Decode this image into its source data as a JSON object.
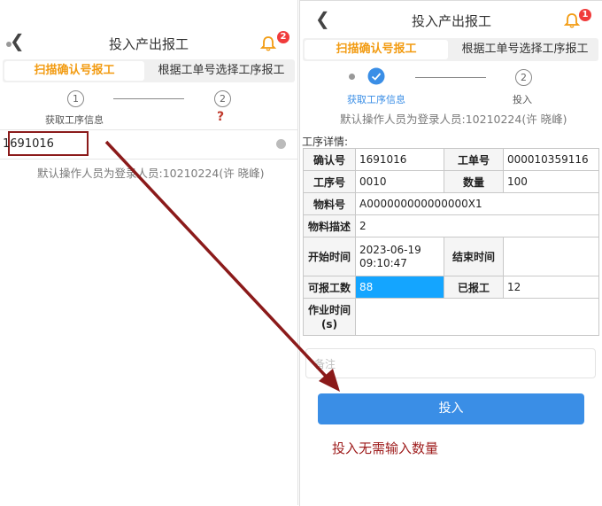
{
  "left": {
    "title": "投入产出报工",
    "badge": "2",
    "tabs": [
      "扫描确认号报工",
      "根据工单号选择工序报工"
    ],
    "steps": {
      "one": "1",
      "two": "2",
      "label": "获取工序信息",
      "question": "?"
    },
    "input_value": "1691016",
    "note": "默认操作人员为登录人员:10210224(许 晓峰)"
  },
  "right": {
    "title": "投入产出报工",
    "badge": "1",
    "tabs": [
      "扫描确认号报工",
      "根据工单号选择工序报工"
    ],
    "steps": {
      "two": "2",
      "label_one": "获取工序信息",
      "label_two": "投入"
    },
    "note": "默认操作人员为登录人员:10210224(许 晓峰)",
    "detail_title": "工序详情:",
    "table": {
      "confirm_label": "确认号",
      "confirm_value": "1691016",
      "order_label": "工单号",
      "order_value": "000010359116",
      "op_label": "工序号",
      "op_value": "0010",
      "qty_label": "数量",
      "qty_value": "100",
      "material_label": "物料号",
      "material_value": "A000000000000000X1",
      "desc_label": "物料描述",
      "desc_value": "2",
      "start_label": "开始时间",
      "start_date": "2023-06-19",
      "start_time": "09:10:47",
      "end_label": "结束时间",
      "end_value": "",
      "reportable_label": "可报工数",
      "reportable_value": "88",
      "reported_label": "已报工",
      "reported_value": "12",
      "work_time_label1": "作业时间",
      "work_time_label2": "(s)",
      "work_time_value": ""
    },
    "remark_placeholder": "备注",
    "button": "投入",
    "annotation": "投入无需输入数量"
  },
  "colors": {
    "accent": "#f29b11",
    "primary": "#3a8ee6",
    "highlight": "#14a5ff",
    "arrow": "#8b1a1a"
  }
}
